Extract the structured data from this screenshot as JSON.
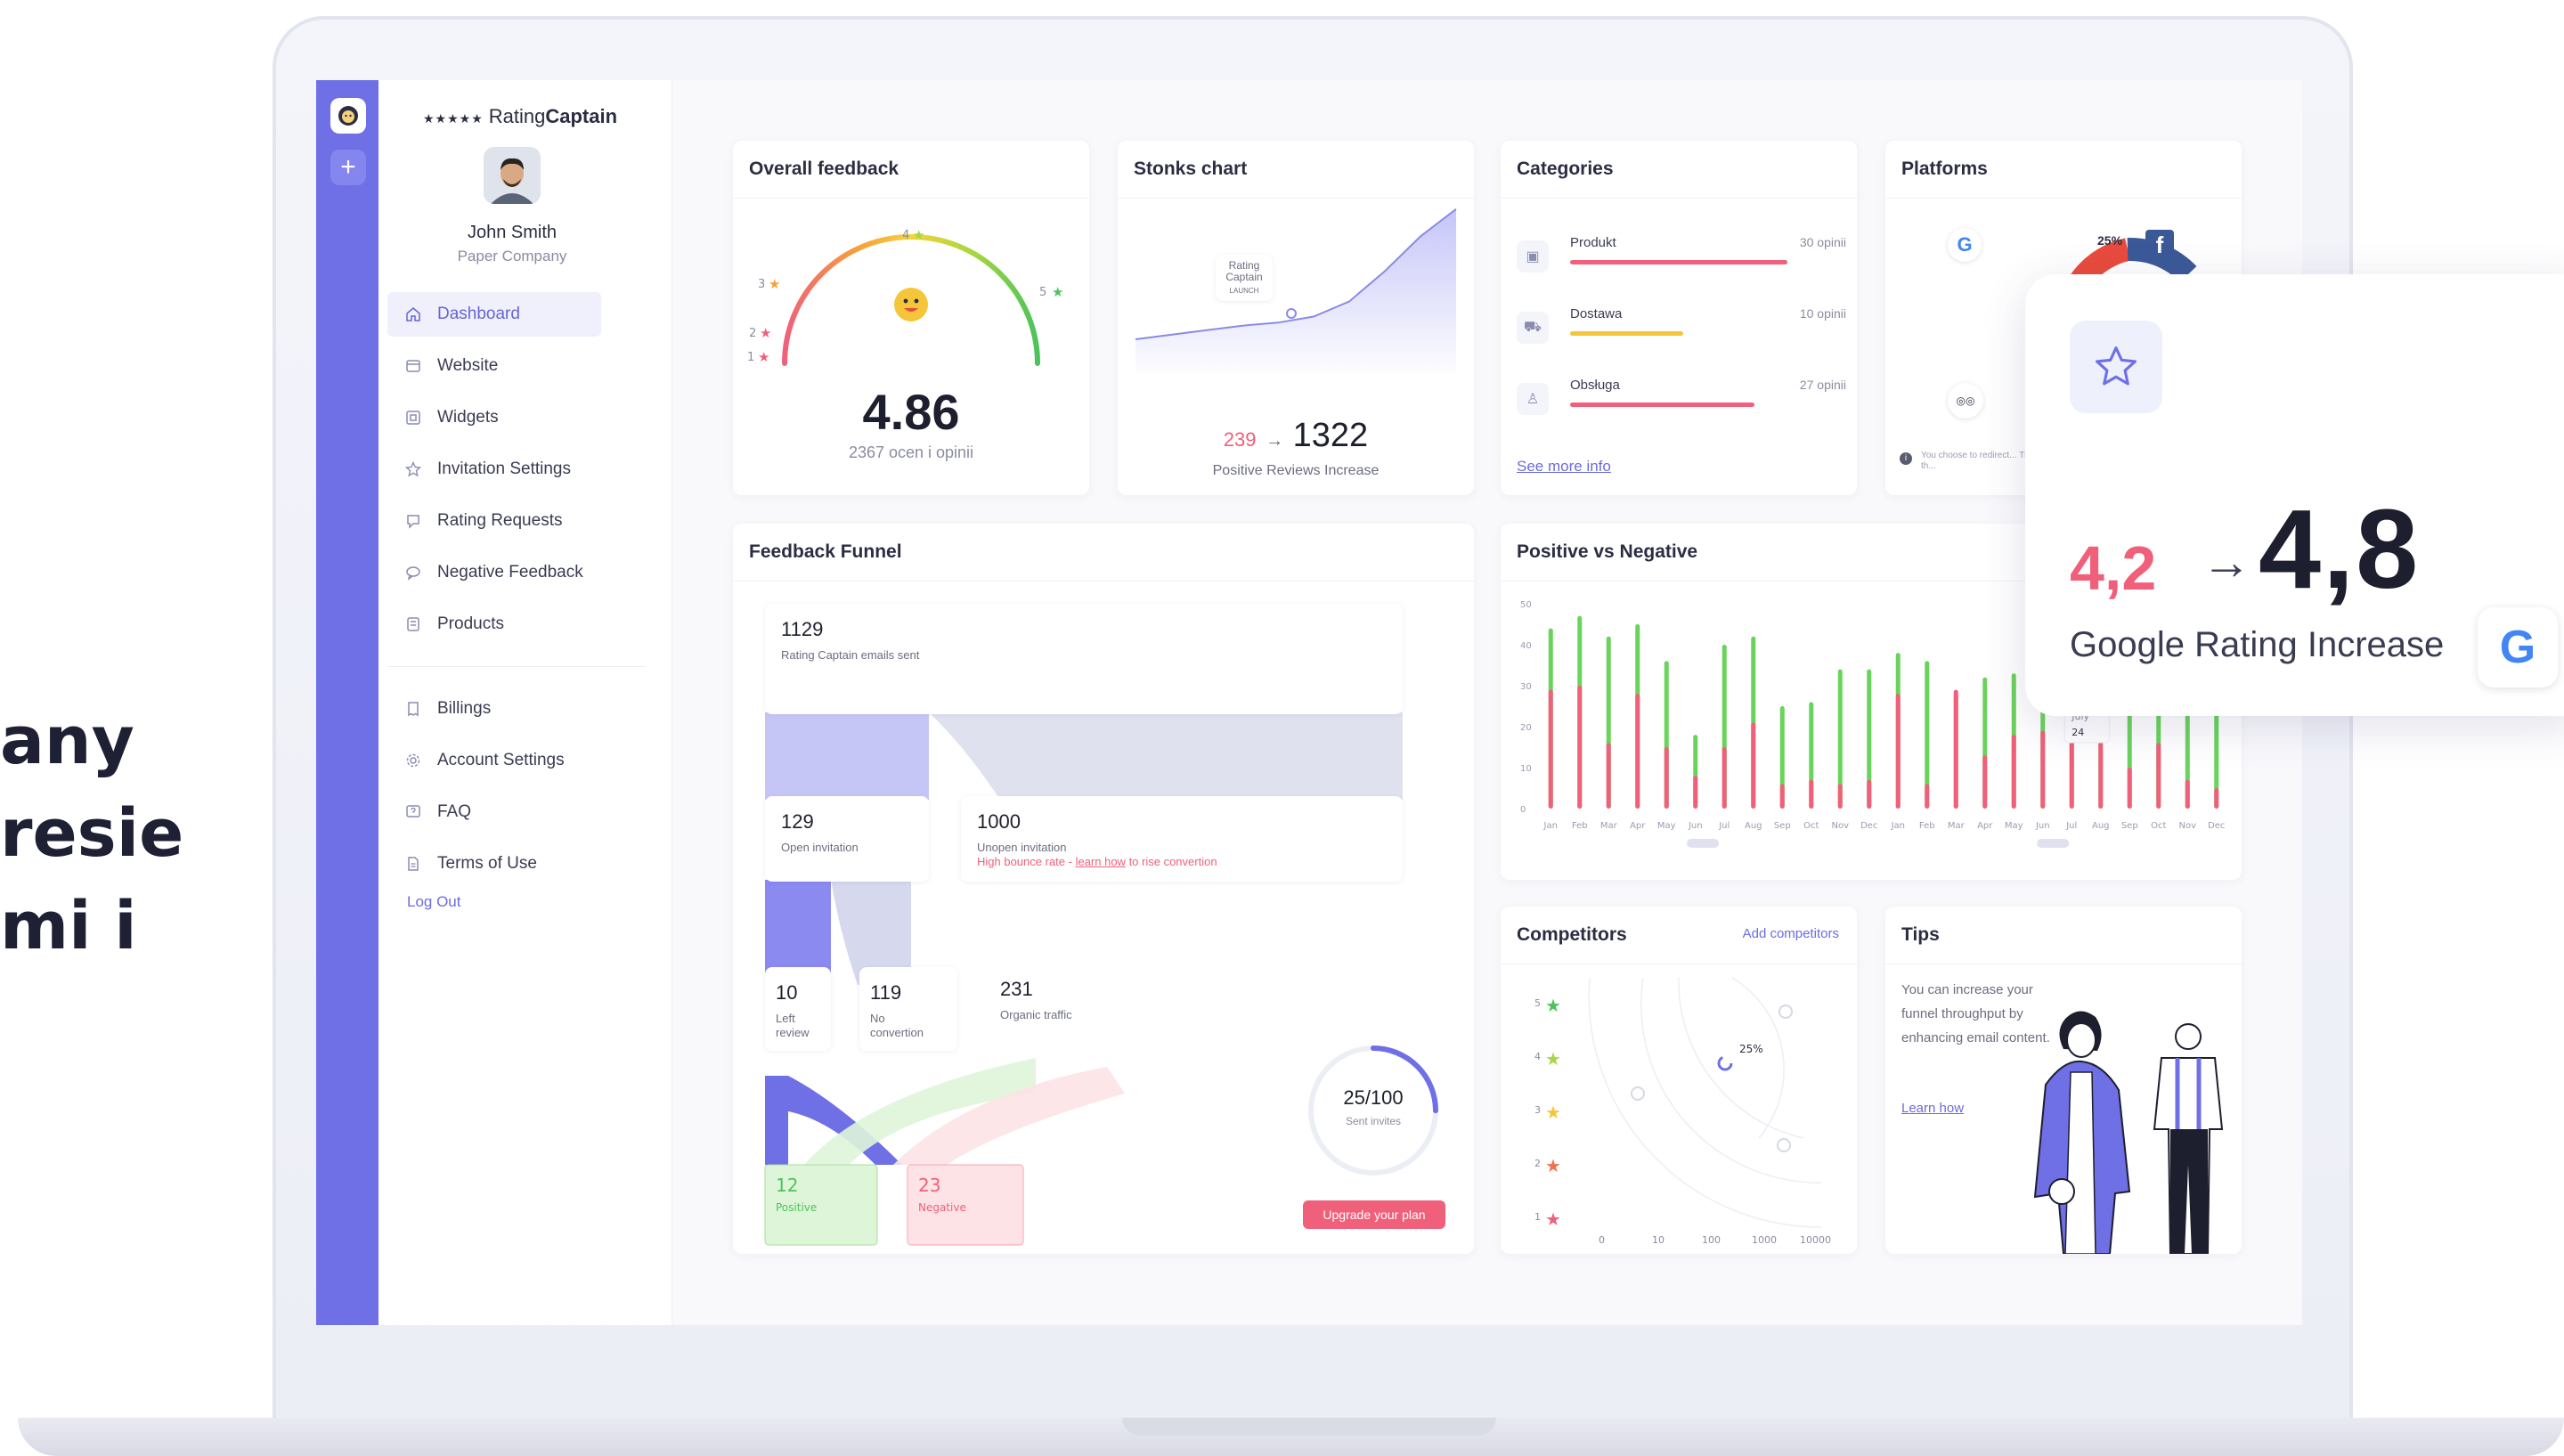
{
  "fragment_lines": [
    "any",
    "resie",
    "mi i"
  ],
  "app": {
    "brand_stars": "★★★★★",
    "brand_prefix": "Rating",
    "brand_suffix": "Captain",
    "user_name": "John Smith",
    "user_company": "Paper Company"
  },
  "sidebar": {
    "items": [
      {
        "label": "Dashboard",
        "icon": "home-icon"
      },
      {
        "label": "Website",
        "icon": "website-icon"
      },
      {
        "label": "Widgets",
        "icon": "widgets-icon"
      },
      {
        "label": "Invitation Settings",
        "icon": "star-outline-icon"
      },
      {
        "label": "Rating Requests",
        "icon": "request-icon"
      },
      {
        "label": "Negative Feedback",
        "icon": "chat-icon"
      },
      {
        "label": "Products",
        "icon": "products-icon"
      }
    ],
    "secondary": [
      {
        "label": "Billings",
        "icon": "billing-icon"
      },
      {
        "label": "Account Settings",
        "icon": "gear-icon"
      },
      {
        "label": "FAQ",
        "icon": "faq-icon"
      },
      {
        "label": "Terms of Use",
        "icon": "document-icon"
      }
    ],
    "logout": "Log Out"
  },
  "overall_feedback": {
    "title": "Overall feedback",
    "rating": "4.86",
    "subtitle": "2367 ocen i opinii",
    "scale_labels": [
      "1",
      "2",
      "3",
      "4",
      "5"
    ],
    "rating_fraction": 0.965
  },
  "stonks": {
    "title": "Stonks chart",
    "badge_lines": [
      "Rating",
      "Captain",
      "LAUNCH"
    ],
    "from": "239",
    "arrow": "→",
    "to": "1322",
    "subtitle": "Positive Reviews Increase",
    "series": [
      0.1,
      0.13,
      0.16,
      0.19,
      0.21,
      0.25,
      0.35,
      0.55,
      0.78,
      0.96
    ]
  },
  "categories": {
    "title": "Categories",
    "items": [
      {
        "name": "Produkt",
        "count": "30 opinii",
        "fill": 1.0,
        "color": "#f0607a",
        "icon": "box-icon"
      },
      {
        "name": "Dostawa",
        "count": "10 opinii",
        "fill": 0.52,
        "color": "#f5c53a",
        "icon": "truck-icon"
      },
      {
        "name": "Obsługa",
        "count": "27 opinii",
        "fill": 0.85,
        "color": "#f0607a",
        "icon": "person-icon"
      }
    ],
    "see_more": "See more info"
  },
  "platforms": {
    "title": "Platforms",
    "pct": "25%",
    "note": "You choose to redirect... They may affect th...",
    "colors": {
      "google_red": "#e94b3c",
      "google_green": "#34a853",
      "facebook": "#3b5998"
    }
  },
  "funnel": {
    "title": "Feedback Funnel",
    "sent": {
      "value": "1129",
      "label": "Rating Captain emails sent"
    },
    "open": {
      "value": "129",
      "label": "Open invitation"
    },
    "unopen": {
      "value": "1000",
      "label": "Unopen invitation",
      "warn": "High bounce rate - ",
      "link": "learn how",
      "warn_tail": " to rise convertion"
    },
    "left_review": {
      "value": "10",
      "label": "Left review"
    },
    "no_conversion": {
      "value": "119",
      "label": "No convertion"
    },
    "organic": {
      "value": "231",
      "label": "Organic traffic"
    },
    "positive": {
      "value": "12",
      "label": "Positive"
    },
    "negative": {
      "value": "23",
      "label": "Negative"
    },
    "sent_invites": {
      "value": "25/100",
      "label": "Sent invites",
      "fraction": 0.25
    },
    "upgrade": "Upgrade your plan"
  },
  "positive_vs_negative": {
    "title": "Positive vs Negative",
    "y_ticks": [
      "50",
      "40",
      "30",
      "20",
      "10",
      "0"
    ],
    "months": [
      "Jan",
      "Feb",
      "Mar",
      "Apr",
      "May",
      "Jun",
      "Jul",
      "Aug",
      "Sep",
      "Oct",
      "Nov",
      "Dec",
      "Jan",
      "Feb",
      "Mar",
      "Apr",
      "May",
      "Jun",
      "Jul",
      "Aug",
      "Sep",
      "Oct",
      "Nov",
      "Dec"
    ],
    "positive": [
      44,
      47,
      42,
      45,
      36,
      18,
      40,
      42,
      25,
      26,
      34,
      34,
      38,
      36,
      28,
      32,
      33,
      38,
      36,
      30,
      26,
      34,
      25,
      32
    ],
    "negative": [
      29,
      30,
      16,
      28,
      15,
      8,
      15,
      21,
      6,
      7,
      6,
      7,
      28,
      6,
      29,
      13,
      18,
      19,
      18,
      18,
      10,
      16,
      7,
      5
    ],
    "tooltip_month": "July",
    "tooltip_value": "24",
    "colors": {
      "positive": "#6ad35c",
      "negative": "#f0607a"
    }
  },
  "competitors": {
    "title": "Competitors",
    "add": "Add competitors",
    "rows": [
      "5",
      "4",
      "3",
      "2",
      "1"
    ],
    "x_ticks": [
      "0",
      "10",
      "100",
      "1000",
      "10000"
    ],
    "pct": "25%"
  },
  "tips": {
    "title": "Tips",
    "text": "You can increase your funnel throughput by enhancing email content.",
    "link": "Learn how"
  },
  "overlay": {
    "from": "4,2",
    "arrow": "→",
    "to": "4,8",
    "label": "Google Rating Increase",
    "g": "G"
  }
}
